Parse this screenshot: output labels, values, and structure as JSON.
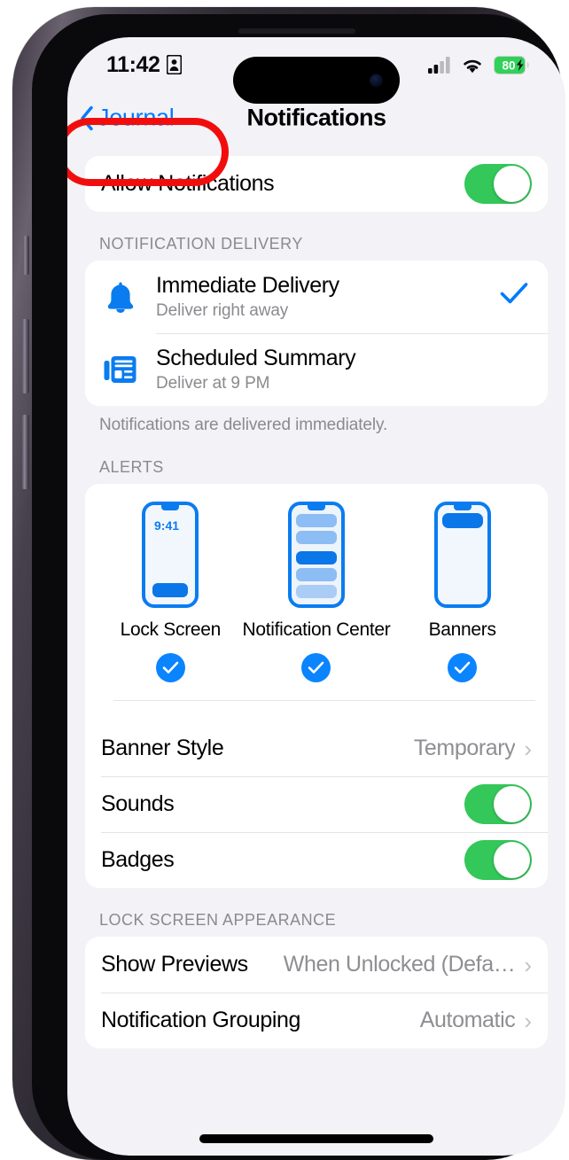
{
  "status_bar": {
    "time": "11:42",
    "person_icon": "person-id-icon",
    "cellular_icon": "cellular-signal-icon",
    "wifi_icon": "wifi-icon",
    "battery_percent": "80",
    "battery_charging": true
  },
  "nav": {
    "back_label": "Journal",
    "back_icon": "chevron-left-icon",
    "title": "Notifications"
  },
  "annotation": {
    "type": "red-highlight-ring",
    "color": "#f20d0d",
    "targets": "back-button"
  },
  "allow": {
    "label": "Allow Notifications",
    "toggle_on": true
  },
  "delivery": {
    "header": "NOTIFICATION DELIVERY",
    "footer": "Notifications are delivered immediately.",
    "options": [
      {
        "icon": "bell-icon",
        "title": "Immediate Delivery",
        "subtitle": "Deliver right away",
        "selected": true
      },
      {
        "icon": "newspaper-summary-icon",
        "title": "Scheduled Summary",
        "subtitle": "Deliver at 9 PM",
        "selected": false
      }
    ]
  },
  "alerts": {
    "header": "ALERTS",
    "options": [
      {
        "label": "Lock Screen",
        "style": "lock-screen",
        "time_label": "9:41",
        "checked": true
      },
      {
        "label": "Notification Center",
        "style": "notification-center",
        "checked": true
      },
      {
        "label": "Banners",
        "style": "banners",
        "checked": true
      }
    ],
    "rows": [
      {
        "label": "Banner Style",
        "value": "Temporary",
        "type": "disclosure"
      },
      {
        "label": "Sounds",
        "value": "",
        "type": "toggle",
        "toggle_on": true
      },
      {
        "label": "Badges",
        "value": "",
        "type": "toggle",
        "toggle_on": true
      }
    ]
  },
  "lock_screen_appearance": {
    "header": "LOCK SCREEN APPEARANCE",
    "rows": [
      {
        "label": "Show Previews",
        "value": "When Unlocked (Defa…",
        "type": "disclosure"
      },
      {
        "label": "Notification Grouping",
        "value": "Automatic",
        "type": "disclosure"
      }
    ]
  },
  "colors": {
    "accent_blue": "#007aff",
    "toggle_green": "#34c759",
    "check_blue": "#0a84ff",
    "annotation_red": "#f20d0d",
    "page_bg": "#f2f2f7"
  }
}
